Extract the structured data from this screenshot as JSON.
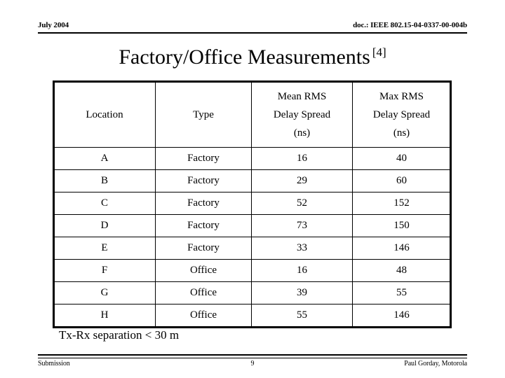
{
  "header": {
    "date": "July 2004",
    "doc_id": "doc.: IEEE 802.15-04-0337-00-004b"
  },
  "title": {
    "text": "Factory/Office Measurements",
    "reference": "[4]"
  },
  "table": {
    "columns": [
      {
        "line1": "",
        "line2": "Location",
        "line3": ""
      },
      {
        "line1": "",
        "line2": "Type",
        "line3": ""
      },
      {
        "line1": "Mean RMS",
        "line2": "Delay Spread",
        "line3": "(ns)"
      },
      {
        "line1": "Max RMS",
        "line2": "Delay Spread",
        "line3": "(ns)"
      }
    ],
    "rows": [
      {
        "location": "A",
        "type": "Factory",
        "mean_rms_ds_ns": "16",
        "max_rms_ds_ns": "40"
      },
      {
        "location": "B",
        "type": "Factory",
        "mean_rms_ds_ns": "29",
        "max_rms_ds_ns": "60"
      },
      {
        "location": "C",
        "type": "Factory",
        "mean_rms_ds_ns": "52",
        "max_rms_ds_ns": "152"
      },
      {
        "location": "D",
        "type": "Factory",
        "mean_rms_ds_ns": "73",
        "max_rms_ds_ns": "150"
      },
      {
        "location": "E",
        "type": "Factory",
        "mean_rms_ds_ns": "33",
        "max_rms_ds_ns": "146"
      },
      {
        "location": "F",
        "type": "Office",
        "mean_rms_ds_ns": "16",
        "max_rms_ds_ns": "48"
      },
      {
        "location": "G",
        "type": "Office",
        "mean_rms_ds_ns": "39",
        "max_rms_ds_ns": "55"
      },
      {
        "location": "H",
        "type": "Office",
        "mean_rms_ds_ns": "55",
        "max_rms_ds_ns": "146"
      }
    ]
  },
  "note": "Tx-Rx separation < 30 m",
  "footer": {
    "left": "Submission",
    "page": "9",
    "right": "Paul Gorday, Motorola"
  }
}
